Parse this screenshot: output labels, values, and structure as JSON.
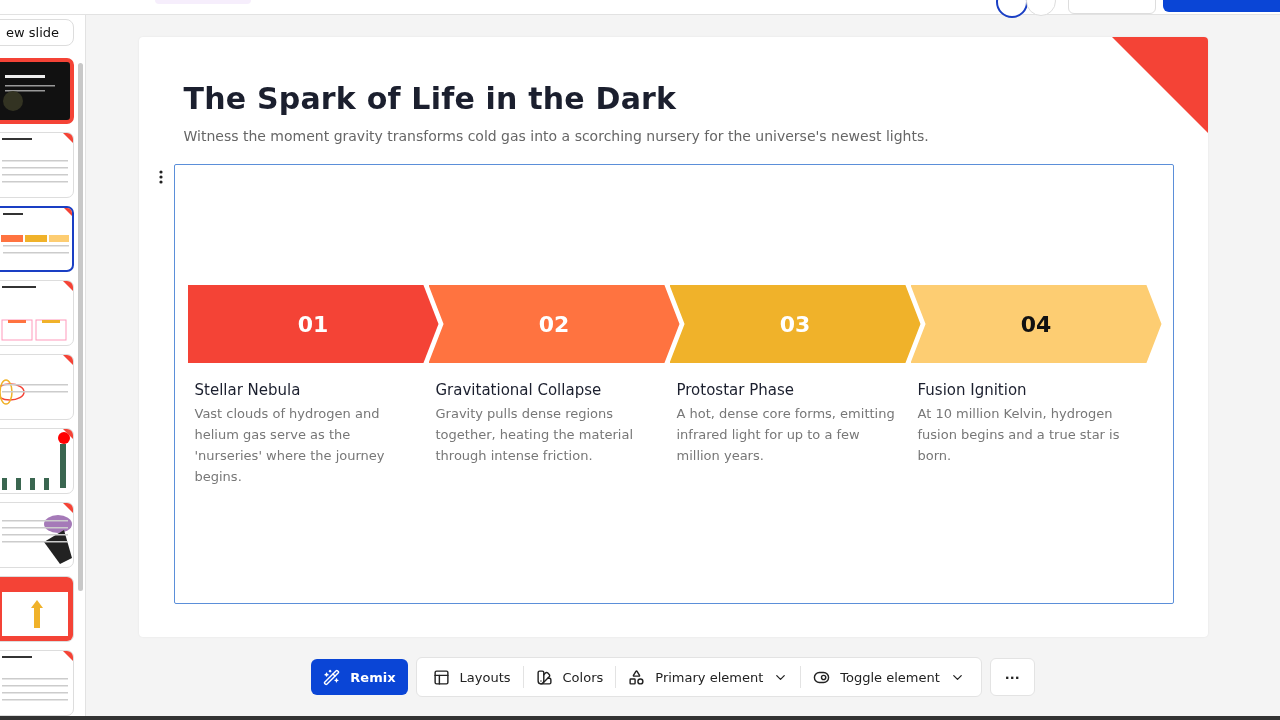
{
  "sidebar": {
    "new_slide_button": "ew slide",
    "slides": [
      {
        "kind": "dark",
        "selected": false
      },
      {
        "kind": "lines",
        "selected": false
      },
      {
        "kind": "steps",
        "selected": true
      },
      {
        "kind": "stats",
        "selected": false
      },
      {
        "kind": "rings",
        "selected": false
      },
      {
        "kind": "bars",
        "selected": false
      },
      {
        "kind": "image",
        "selected": false
      },
      {
        "kind": "arrow",
        "selected": false
      },
      {
        "kind": "lines",
        "selected": false
      }
    ]
  },
  "slide": {
    "title": "The Spark of Life in the Dark",
    "subtitle": "Witness the moment gravity transforms cold gas into a scorching nursery for the universe's newest lights.",
    "steps": [
      {
        "number": "01",
        "color": "#f44336",
        "title": "Stellar Nebula",
        "text": "Vast clouds of hydrogen and helium gas serve as the 'nurseries' where the journey begins."
      },
      {
        "number": "02",
        "color": "#ff7340",
        "title": "Gravitational Collapse",
        "text": "Gravity pulls dense regions together, heating the material through intense friction."
      },
      {
        "number": "03",
        "color": "#f0b22a",
        "title": "Protostar Phase",
        "text": "A hot, dense core forms, emitting infrared light for up to a few million years."
      },
      {
        "number": "04",
        "color": "#fdcd72",
        "title": "Fusion Ignition",
        "text": "At 10 million Kelvin, hydrogen fusion begins and a true star is born."
      }
    ]
  },
  "toolbar": [
    {
      "kind": "primary",
      "label": "Remix"
    },
    {
      "kind": "layouts",
      "label": "Layouts"
    },
    {
      "kind": "colors",
      "label": "Colors"
    },
    {
      "kind": "dropdown-shapes",
      "label": "Primary element"
    },
    {
      "kind": "dropdown-toggle",
      "label": "Toggle element"
    },
    {
      "kind": "more",
      "label": "···"
    }
  ]
}
